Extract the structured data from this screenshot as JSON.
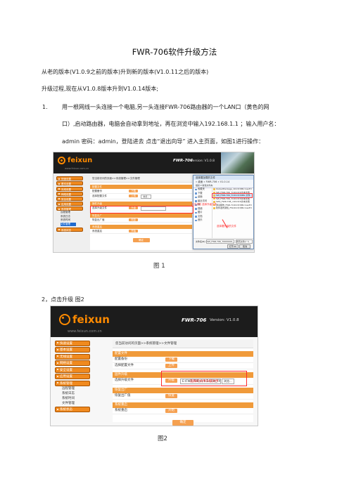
{
  "doc": {
    "title": "FWR-706软件升级方法",
    "intro": "从老的版本(V1.0.9之前的版本)升到新的版本(V1.0.11之后的版本)",
    "process": "升级过程,现在从V1.0.8版本升到V1.0.14版本;",
    "step1_num": "1.",
    "step1_l1": "用一根网线一头连接一个电脑,另一头连接FWR-706路由器的一个LAN口（黄色的网",
    "step1_l2": "口）,启动路由器，电脑会自动拿到地址，再在浏览中输入192.168.1.1 ；输入用户名：",
    "step1_l3": "admin 密码：admin，登陆进去 点击“退出向导” 进入主页面，如图1进行操作：",
    "fig1_caption": "图  1",
    "step2": "2，点击升级  图2",
    "fig2_caption": "图2"
  },
  "router": {
    "logo": "feixun",
    "site": "www.feixun.com.cn",
    "model": "FWR-706",
    "version": "Version: V1.0.8",
    "version2": "Version: V1.0.8",
    "menu": [
      "快速设置",
      "基本设置",
      "无线设置",
      "网络设置",
      "安全设置",
      "应用设置",
      "系统管理"
    ],
    "menu_sub": [
      "远程管理",
      "系统日志",
      "系统时间",
      "文件管理"
    ],
    "menu_last": "系统状态",
    "breadcrumb": "您当前访问的页面>>系统管理>>文件管理",
    "sec_config": "配置文件",
    "config_backup": "配置备份",
    "config_select": "选择配置文件",
    "btn_download": "下载",
    "btn_upload": "上传",
    "btn_browse": "浏览...",
    "sec_firmware": "固件升级",
    "firmware_select": "选择升级文件",
    "btn_upgrade": "升级",
    "sec_factory": "恢复出厂",
    "factory_restore": "恢复出厂值",
    "btn_restore": "恢复",
    "sec_reboot": "系统重启",
    "reboot": "系统重启",
    "btn_start": "开始",
    "btn_ok": "确定",
    "fw_path": "E:\\FWR-706\\v1.0.14\\SW_FWR",
    "fig2_note": "选择的文件升级文件"
  },
  "dialog": {
    "title": "选择要加载的文件",
    "path": "« 桌面 » FWR-706 » V1.0.14",
    "toolbar": "组织 ▾    新建文件夹",
    "nav": [
      "收藏夹",
      "下载",
      "桌面",
      "最近访问",
      "库",
      "视频",
      "图片",
      "文档",
      "音乐"
    ],
    "files": [
      {
        "name": "OutputPackage_FWR-706_70000001_V1.0...",
        "date": "2013/3/8 9:55",
        "type": "Microsoft Excel ..."
      },
      {
        "name": "SW_FWR-706_70000001_V1.0.14.txt",
        "date": "2013/3/8 9:55",
        "type": "文本文档"
      },
      {
        "name": "SW_FWR-706_70000001_V1.0.14.img",
        "date": "2013/3/8 9:55",
        "type": "IMG 文件"
      },
      {
        "name": "SW_FWR-706_70000001_V1.0.14_MD5.txt",
        "date": "2013/3/8 9:55",
        "type": "文本文档"
      },
      {
        "name": "SWs_FWR-706_70000001_V1.0.14.txt",
        "date": "2013/3/8 9:55",
        "type": "文本文档"
      },
      {
        "name": "测试报告_FWR-706_70000001_V1.0.14...",
        "date": "2013/3/8 9:55",
        "type": "Microsoft Excel ..."
      },
      {
        "name": "软件发布通知_FWR-706_V1.0.14_201303...",
        "date": "2013/3/8 9:55",
        "type": "Microsoft Excel ..."
      }
    ],
    "filename_label": "文件名(N):",
    "filename_value": "SW_FWR-706_70000001_V1.0.14.img",
    "filter": "所有文件(*.*)",
    "btn_open": "打开(O)",
    "btn_cancel": "取消",
    "note_select": "点击浏览 选择升级文件",
    "note_file": "选择要升级的文件"
  }
}
